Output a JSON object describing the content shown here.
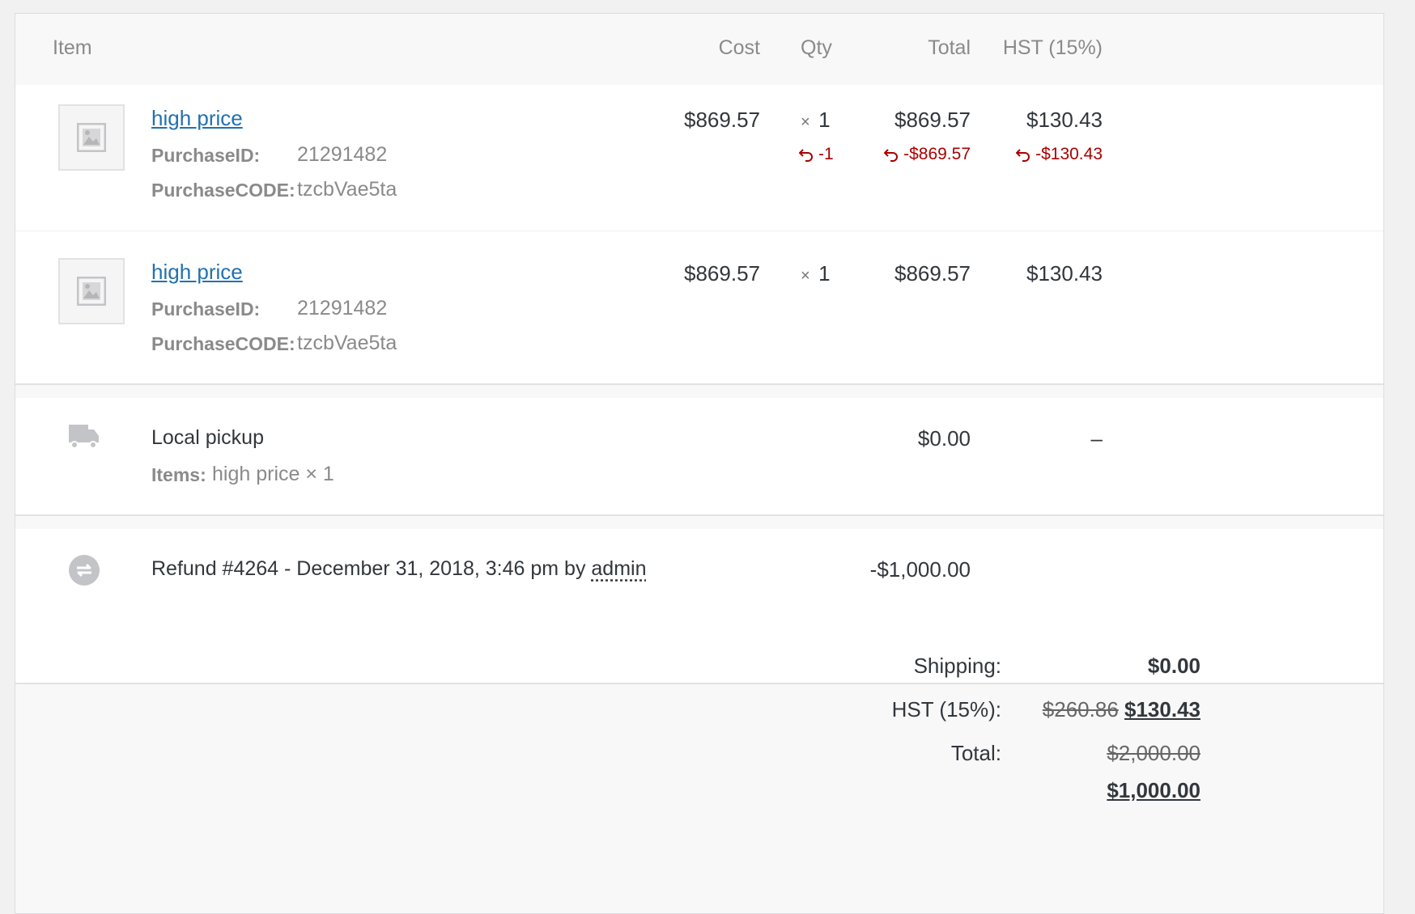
{
  "headers": {
    "item": "Item",
    "cost": "Cost",
    "qty": "Qty",
    "total": "Total",
    "tax": "HST (15%)"
  },
  "line_items": [
    {
      "name": "high price",
      "meta": [
        {
          "key": "PurchaseID:",
          "value": "21291482"
        },
        {
          "key": "PurchaseCODE:",
          "value": "tzcbVae5ta"
        }
      ],
      "cost": "$869.57",
      "qty_prefix": "×",
      "qty": "1",
      "total": "$869.57",
      "tax": "$130.43",
      "refunded_qty": "-1",
      "refunded_total": "-$869.57",
      "refunded_tax": "-$130.43"
    },
    {
      "name": "high price",
      "meta": [
        {
          "key": "PurchaseID:",
          "value": "21291482"
        },
        {
          "key": "PurchaseCODE:",
          "value": "tzcbVae5ta"
        }
      ],
      "cost": "$869.57",
      "qty_prefix": "×",
      "qty": "1",
      "total": "$869.57",
      "tax": "$130.43"
    }
  ],
  "shipping": {
    "method": "Local pickup",
    "items_label": "Items:",
    "items_value": "high price × 1",
    "total": "$0.00",
    "tax": "–"
  },
  "refund": {
    "text": "Refund #4264 - December 31, 2018, 3:46 pm by",
    "user": "admin",
    "amount": "-$1,000.00"
  },
  "totals": {
    "shipping_label": "Shipping:",
    "shipping_value": "$0.00",
    "tax_label": "HST (15%):",
    "tax_old": "$260.86",
    "tax_new": "$130.43",
    "total_label": "Total:",
    "total_old": "$2,000.00",
    "total_new": "$1,000.00"
  },
  "colors": {
    "link": "#2271b1",
    "refund": "#aa0000"
  },
  "icons": {
    "product": "image-placeholder-icon",
    "shipping": "truck-icon",
    "refund": "refund-arrows-icon",
    "refund_line": "undo-arrow-icon"
  }
}
